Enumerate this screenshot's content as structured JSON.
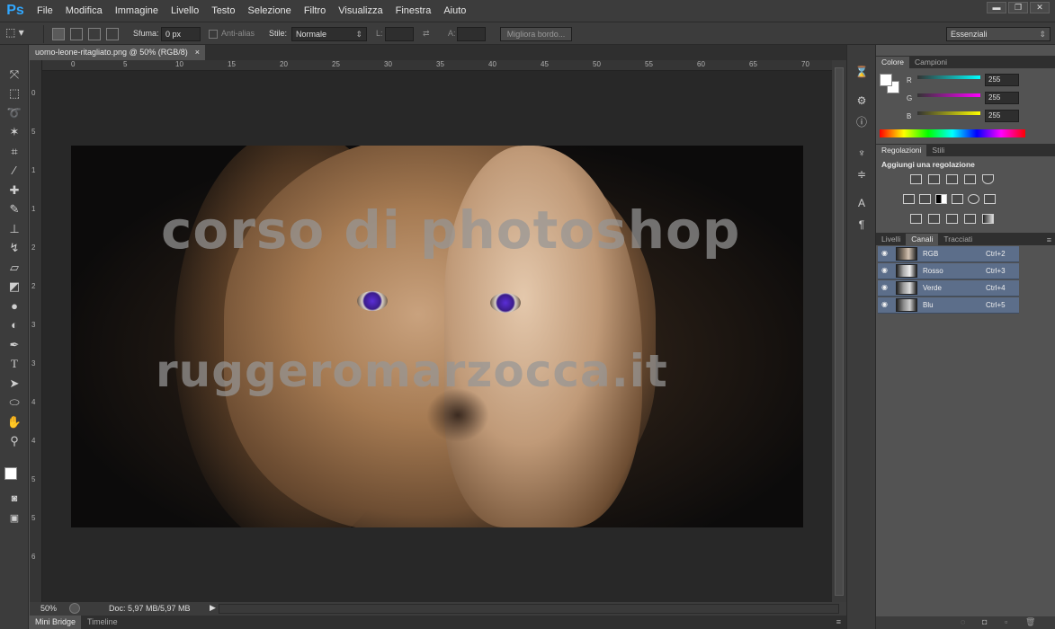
{
  "app": {
    "logo": "Ps"
  },
  "menu": [
    "File",
    "Modifica",
    "Immagine",
    "Livello",
    "Testo",
    "Selezione",
    "Filtro",
    "Visualizza",
    "Finestra",
    "Aiuto"
  ],
  "window_buttons": [
    "▬",
    "❐",
    "✕"
  ],
  "options": {
    "feather_label": "Sfuma:",
    "feather_value": "0 px",
    "antialias_label": "Anti-alias",
    "style_label": "Stile:",
    "style_value": "Normale",
    "width_label": "L:",
    "height_label": "A:",
    "refine_button": "Migliora bordo...",
    "workspace": "Essenziali"
  },
  "document": {
    "tab_title": "uomo-leone-ritagliato.png @ 50% (RGB/8)",
    "tab_close": "×",
    "watermark_line1": "corso di photoshop",
    "watermark_line2": "ruggeromarzocca.it"
  },
  "rulers": {
    "h": [
      "0",
      "5",
      "10",
      "15",
      "20",
      "25",
      "30",
      "35",
      "40",
      "45",
      "50",
      "55",
      "60",
      "65",
      "70"
    ],
    "v": [
      "0",
      "5",
      "1",
      "1",
      "2",
      "2",
      "3",
      "3",
      "4",
      "4",
      "5",
      "5",
      "6"
    ]
  },
  "status": {
    "zoom": "50%",
    "doc": "Doc: 5,97 MB/5,97 MB"
  },
  "bottom_tabs": [
    "Mini Bridge",
    "Timeline"
  ],
  "color_panel": {
    "tabs": [
      "Colore",
      "Campioni"
    ],
    "sliders": [
      {
        "label": "R",
        "value": "255",
        "color": "#00ffff"
      },
      {
        "label": "G",
        "value": "255",
        "color": "#ff00ff"
      },
      {
        "label": "B",
        "value": "255",
        "color": "#ffff00"
      }
    ]
  },
  "adjust_panel": {
    "tabs": [
      "Regolazioni",
      "Stili"
    ],
    "title": "Aggiungi una regolazione"
  },
  "channels_panel": {
    "tabs": [
      "Livelli",
      "Canali",
      "Tracciati"
    ],
    "channels": [
      {
        "name": "RGB",
        "shortcut": "Ctrl+2"
      },
      {
        "name": "Rosso",
        "shortcut": "Ctrl+3"
      },
      {
        "name": "Verde",
        "shortcut": "Ctrl+4"
      },
      {
        "name": "Blu",
        "shortcut": "Ctrl+5"
      }
    ]
  }
}
